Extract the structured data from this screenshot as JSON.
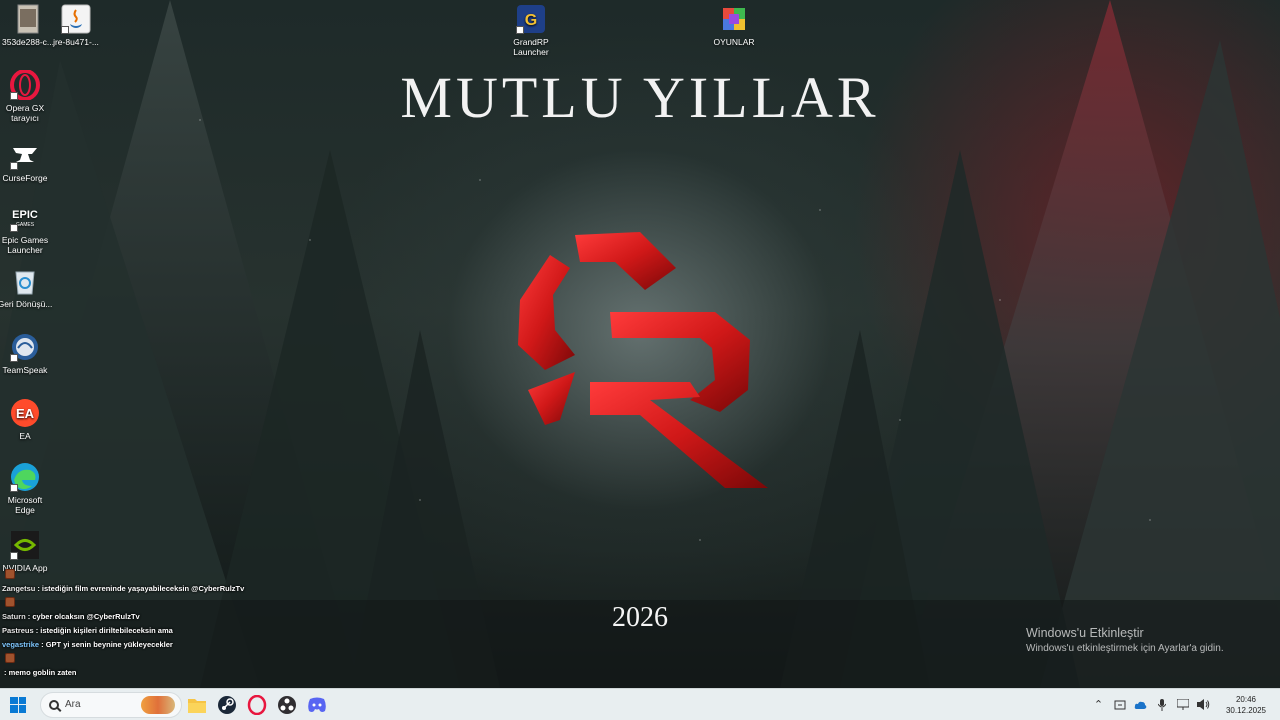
{
  "wallpaper": {
    "title": "MUTLU YILLAR",
    "year": "2026"
  },
  "activation": {
    "title": "Windows'u Etkinleştir",
    "subtitle": "Windows'u etkinleştirmek için Ayarlar'a gidin."
  },
  "desktop_icons": [
    {
      "label": "353de288-c...",
      "icon": "image-file-icon"
    },
    {
      "label": "jre-8u471-...",
      "icon": "java-icon"
    },
    {
      "label": "Opera GX tarayıcı",
      "icon": "opera-gx-icon"
    },
    {
      "label": "CurseForge",
      "icon": "curseforge-icon"
    },
    {
      "label": "Epic Games Launcher",
      "icon": "epic-games-icon"
    },
    {
      "label": "Geri Dönüşü...",
      "icon": "recycle-bin-icon"
    },
    {
      "label": "TeamSpeak",
      "icon": "teamspeak-icon"
    },
    {
      "label": "EA",
      "icon": "ea-icon"
    },
    {
      "label": "Microsoft Edge",
      "icon": "edge-icon"
    },
    {
      "label": "NVIDIA App",
      "icon": "nvidia-icon"
    },
    {
      "label": "GrandRP Launcher",
      "icon": "grandrp-icon"
    },
    {
      "label": "OYUNLAR",
      "icon": "games-folder-icon"
    }
  ],
  "chat": [
    {
      "user": "Zangetsu",
      "user_color": "#e8e8e8",
      "message": ": istediğin film evreninde yaşayabileceksin @CyberRulzTv"
    },
    {
      "user": "Saturn",
      "user_color": "#e0e0e0",
      "message": ": cyber olcaksın @CyberRulzTv"
    },
    {
      "user": "Pastreus",
      "user_color": "#e8e8e8",
      "message": ": istediğin kişileri diriltebileceksin ama"
    },
    {
      "user": "vegastrike",
      "user_color": "#7fc8ff",
      "message": ": GPT yi senin beynine yükleyecekler"
    },
    {
      "user": "",
      "user_color": "#ffffff",
      "message": ": memo goblin zaten"
    }
  ],
  "taskbar": {
    "search_placeholder": "Ara",
    "apps": [
      "file-explorer-icon",
      "steam-icon",
      "opera-gx-icon",
      "obs-icon",
      "discord-icon"
    ],
    "time": "20:46",
    "date": "30.12.2025"
  },
  "colors": {
    "accent_red": "#d01818",
    "taskbar_bg": "#e8eef0",
    "windows_blue": "#0a7ad4"
  }
}
